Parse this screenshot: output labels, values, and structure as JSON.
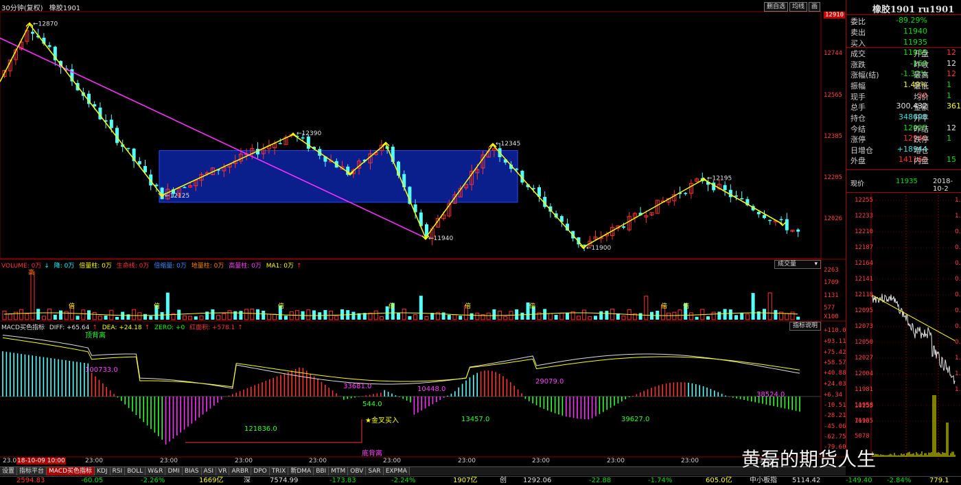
{
  "header": {
    "period": "30分钟(复权)",
    "symbol": "橡胶1901",
    "buttons": [
      "删自选",
      "均线",
      "画"
    ]
  },
  "price_axis": [
    "12910",
    "12744",
    "12565",
    "12385",
    "12205",
    "12026"
  ],
  "price_labels": {
    "p12870": "12870",
    "p12125": "12125",
    "p12390": "12390",
    "p11940": "11940",
    "p12345": "12345",
    "p11900": "11900",
    "p12195": "12195"
  },
  "volume": {
    "title": "VOLUME: 0万",
    "items": [
      {
        "label": "降: 0万",
        "color": "#00ffff"
      },
      {
        "label": "倍量柱: 0万",
        "color": "#ffff00"
      },
      {
        "label": "生命线: 0万",
        "color": "#ff3232"
      },
      {
        "label": "倍缩量: 0万",
        "color": "#0080ff"
      },
      {
        "label": "地量柱: 0万",
        "color": "#ff8000"
      },
      {
        "label": "高量柱: 0万",
        "color": "#ff40ff"
      },
      {
        "label": "MA1: 0万",
        "color": "#ffff00"
      }
    ],
    "axis": [
      "2263",
      "1709",
      "1131",
      "577",
      "X100"
    ],
    "dropdown": "成交量",
    "high_label": "高",
    "bei_label": "倍"
  },
  "macd": {
    "title": "MACD买色指标",
    "diff": "DIFF: +65.64",
    "dea": "DEA: +24.18",
    "zero": "ZERO: +0",
    "hongmu": "红面积: +578.1",
    "dropdown": "指标说明",
    "axis": [
      "+110.0",
      "+93.11",
      "+75.42",
      "+58.57",
      "+40.88",
      "+24.03",
      "+6.34",
      "-10.51",
      "-28.21",
      "-45.06",
      "-62.75",
      "-79.60"
    ],
    "annotations": {
      "top_div": "顶背离",
      "bottom_div": "底背离",
      "golden_cross": "金叉买入",
      "a1": "100733.0",
      "a2": "121836.0",
      "a3": "33681.0",
      "a4": "544.0",
      "a5": "10448.0",
      "a6": "13457.0",
      "a7": "29079.0",
      "a8": "39627.0",
      "a9": "38524.0"
    }
  },
  "time_axis": {
    "first": "18-10-09 10:00",
    "labels": [
      "23:00",
      "23:00",
      "23:00",
      "23:00",
      "23:00",
      "23:00",
      "23:00",
      "23:00",
      "23:00",
      "23:00"
    ]
  },
  "tabs": [
    "设置",
    "指标平台",
    "MACD买色指标",
    "KDJ",
    "RSI",
    "BOLL",
    "W&R",
    "DMI",
    "BIAS",
    "ASI",
    "VR",
    "ARBR",
    "DPO",
    "TRIX",
    "新DMA",
    "BBI",
    "MTM",
    "OBV",
    "SAR",
    "EXPMA"
  ],
  "active_tab": "MACD买色指标",
  "right_panel": {
    "title": "橡胶1901 ru1901",
    "rows": [
      {
        "k": "委比",
        "v": "-89.29%",
        "vc": "green"
      },
      {
        "k": "卖出",
        "v": "11940",
        "vc": "green"
      },
      {
        "k": "买入",
        "v": "11935",
        "vc": "green"
      },
      {
        "k": "成交",
        "v": "11935",
        "vc": "green",
        "k2": "开盘",
        "v2": "12",
        "v2c": "red"
      },
      {
        "k": "涨跌",
        "v": "-160",
        "vc": "green",
        "k2": "昨收",
        "v2": "12",
        "v2c": "white"
      },
      {
        "k": "涨幅(结)",
        "v": "-1.32%",
        "vc": "green",
        "k2": "最高",
        "v2": "12",
        "v2c": "red"
      },
      {
        "k": "振幅",
        "v": "1.49%",
        "vc": "yellow",
        "k2": "最低",
        "v2": "1",
        "v2c": "green"
      },
      {
        "k": "现手",
        "v": "20",
        "vc": "red",
        "k2": "均价",
        "v2": "1",
        "v2c": "green"
      },
      {
        "k": "总手",
        "v": "300,432",
        "vc": "white",
        "k2": "金额",
        "v2": "361",
        "v2c": "yellow"
      },
      {
        "k": "持仓",
        "v": "348698",
        "vc": "cyan",
        "k2": "开平",
        "v2": "",
        "v2c": "white"
      },
      {
        "k": "今结",
        "v": "12025",
        "vc": "green",
        "k2": "昨结",
        "v2": "12",
        "v2c": "white"
      },
      {
        "k": "涨停",
        "v": "12940",
        "vc": "red",
        "k2": "跌停",
        "v2": "1",
        "v2c": "green"
      },
      {
        "k": "日增仓",
        "v": "+18944",
        "vc": "cyan",
        "k2": "增仓",
        "v2": "",
        "v2c": "white"
      },
      {
        "k": "外盘",
        "v": "141162",
        "vc": "red",
        "k2": "内盘",
        "v2": "15",
        "v2c": "green"
      }
    ],
    "now_label": "现价",
    "now_value": "11935",
    "date": "2018-10-2",
    "mini_axis": [
      "12255",
      "12233",
      "12210",
      "12187",
      "12164",
      "12141",
      "12118",
      "12095",
      "12073",
      "12050",
      "12027",
      "12004",
      "11981",
      "11958",
      "11935"
    ],
    "mini_vol_axis": [
      "10155",
      "7616",
      "5078"
    ],
    "mini_right_axis": [
      "1.",
      "1.",
      "0.",
      "0.",
      "0.",
      "0.",
      "0.",
      "0.",
      "0.",
      "0.",
      "1.",
      "1.",
      "1."
    ]
  },
  "ticker": {
    "v1": "2594.83",
    "c1": "-60.05",
    "p1": "-2.26%",
    "a1": "1669亿",
    "label2": "深",
    "v2": "7574.99",
    "c2": "-173.83",
    "p2": "-2.24%",
    "a2": "1907亿",
    "label3": "创",
    "v3": "1292.06",
    "c3": "-22.88",
    "p3": "-1.74%",
    "a3": "605.0亿",
    "label4": "中小板指",
    "v4": "5114.42",
    "c4": "-149.40",
    "p4": "-2.84%",
    "a4": "779.1"
  },
  "watermark": "黄磊的期货人生",
  "colors": {
    "up": "#ff3232",
    "down": "#54ffff",
    "zigzag": "#ffff00",
    "trend": "#ff30ff",
    "box": "#0a1e8c"
  }
}
